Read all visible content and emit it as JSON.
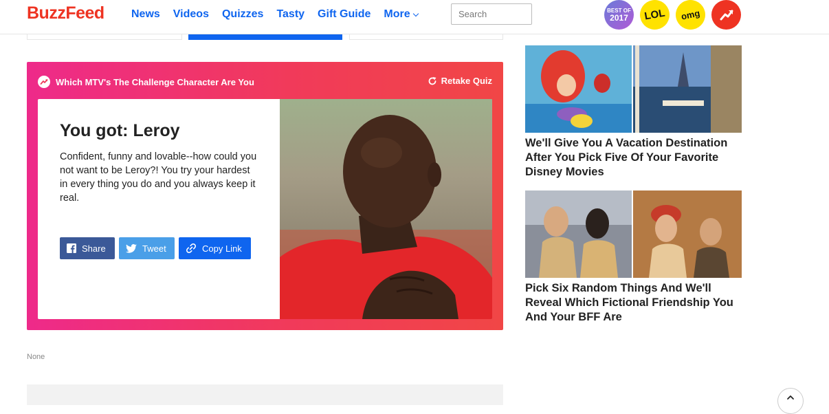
{
  "header": {
    "logo": "BuzzFeed",
    "nav": [
      "News",
      "Videos",
      "Quizzes",
      "Tasty",
      "Gift Guide"
    ],
    "more_label": "More",
    "search_placeholder": "Search",
    "badges": {
      "best_top": "BEST OF",
      "best_year": "2017",
      "lol": "LOL",
      "omg": "omg"
    }
  },
  "result": {
    "quiz_title": "Which MTV's The Challenge Character Are You",
    "retake_label": "Retake Quiz",
    "heading": "You got: Leroy",
    "description": "Confident, funny and lovable--how could you not want to be Leroy?! You try your hardest in every thing you do and you always keep it real.",
    "share": {
      "facebook": "Share",
      "twitter": "Tweet",
      "copy": "Copy Link"
    }
  },
  "footer_note": "None",
  "sidebar": [
    {
      "title": "We'll Give You A Vacation Destination After You Pick Five Of Your Favorite Disney Movies"
    },
    {
      "title": "Pick Six Random Things And We'll Reveal Which Fictional Friendship You And Your BFF Are"
    }
  ],
  "colors": {
    "brand_red": "#ee3322",
    "link_blue": "#0f65ef",
    "facebook": "#3b5998",
    "twitter": "#4a9fe8",
    "result_gradient_start": "#ee2a8a",
    "result_gradient_end": "#f14646"
  },
  "icons": {
    "trending": "trending-arrow-icon",
    "retake": "refresh-icon",
    "facebook": "facebook-icon",
    "twitter": "twitter-bird-icon",
    "link": "chain-link-icon",
    "scroll": "arrow-up-icon"
  }
}
